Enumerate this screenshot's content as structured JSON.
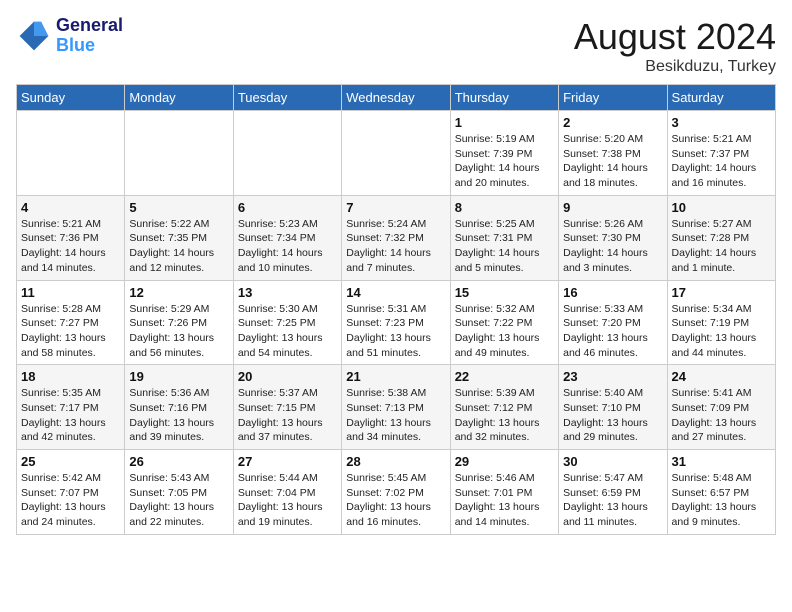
{
  "header": {
    "logo_line1": "General",
    "logo_line2": "Blue",
    "month_title": "August 2024",
    "location": "Besikduzu, Turkey"
  },
  "weekdays": [
    "Sunday",
    "Monday",
    "Tuesday",
    "Wednesday",
    "Thursday",
    "Friday",
    "Saturday"
  ],
  "weeks": [
    [
      null,
      null,
      null,
      null,
      {
        "day": 1,
        "sunrise": "5:19 AM",
        "sunset": "7:39 PM",
        "daylight": "14 hours and 20 minutes."
      },
      {
        "day": 2,
        "sunrise": "5:20 AM",
        "sunset": "7:38 PM",
        "daylight": "14 hours and 18 minutes."
      },
      {
        "day": 3,
        "sunrise": "5:21 AM",
        "sunset": "7:37 PM",
        "daylight": "14 hours and 16 minutes."
      }
    ],
    [
      {
        "day": 4,
        "sunrise": "5:21 AM",
        "sunset": "7:36 PM",
        "daylight": "14 hours and 14 minutes."
      },
      {
        "day": 5,
        "sunrise": "5:22 AM",
        "sunset": "7:35 PM",
        "daylight": "14 hours and 12 minutes."
      },
      {
        "day": 6,
        "sunrise": "5:23 AM",
        "sunset": "7:34 PM",
        "daylight": "14 hours and 10 minutes."
      },
      {
        "day": 7,
        "sunrise": "5:24 AM",
        "sunset": "7:32 PM",
        "daylight": "14 hours and 7 minutes."
      },
      {
        "day": 8,
        "sunrise": "5:25 AM",
        "sunset": "7:31 PM",
        "daylight": "14 hours and 5 minutes."
      },
      {
        "day": 9,
        "sunrise": "5:26 AM",
        "sunset": "7:30 PM",
        "daylight": "14 hours and 3 minutes."
      },
      {
        "day": 10,
        "sunrise": "5:27 AM",
        "sunset": "7:28 PM",
        "daylight": "14 hours and 1 minute."
      }
    ],
    [
      {
        "day": 11,
        "sunrise": "5:28 AM",
        "sunset": "7:27 PM",
        "daylight": "13 hours and 58 minutes."
      },
      {
        "day": 12,
        "sunrise": "5:29 AM",
        "sunset": "7:26 PM",
        "daylight": "13 hours and 56 minutes."
      },
      {
        "day": 13,
        "sunrise": "5:30 AM",
        "sunset": "7:25 PM",
        "daylight": "13 hours and 54 minutes."
      },
      {
        "day": 14,
        "sunrise": "5:31 AM",
        "sunset": "7:23 PM",
        "daylight": "13 hours and 51 minutes."
      },
      {
        "day": 15,
        "sunrise": "5:32 AM",
        "sunset": "7:22 PM",
        "daylight": "13 hours and 49 minutes."
      },
      {
        "day": 16,
        "sunrise": "5:33 AM",
        "sunset": "7:20 PM",
        "daylight": "13 hours and 46 minutes."
      },
      {
        "day": 17,
        "sunrise": "5:34 AM",
        "sunset": "7:19 PM",
        "daylight": "13 hours and 44 minutes."
      }
    ],
    [
      {
        "day": 18,
        "sunrise": "5:35 AM",
        "sunset": "7:17 PM",
        "daylight": "13 hours and 42 minutes."
      },
      {
        "day": 19,
        "sunrise": "5:36 AM",
        "sunset": "7:16 PM",
        "daylight": "13 hours and 39 minutes."
      },
      {
        "day": 20,
        "sunrise": "5:37 AM",
        "sunset": "7:15 PM",
        "daylight": "13 hours and 37 minutes."
      },
      {
        "day": 21,
        "sunrise": "5:38 AM",
        "sunset": "7:13 PM",
        "daylight": "13 hours and 34 minutes."
      },
      {
        "day": 22,
        "sunrise": "5:39 AM",
        "sunset": "7:12 PM",
        "daylight": "13 hours and 32 minutes."
      },
      {
        "day": 23,
        "sunrise": "5:40 AM",
        "sunset": "7:10 PM",
        "daylight": "13 hours and 29 minutes."
      },
      {
        "day": 24,
        "sunrise": "5:41 AM",
        "sunset": "7:09 PM",
        "daylight": "13 hours and 27 minutes."
      }
    ],
    [
      {
        "day": 25,
        "sunrise": "5:42 AM",
        "sunset": "7:07 PM",
        "daylight": "13 hours and 24 minutes."
      },
      {
        "day": 26,
        "sunrise": "5:43 AM",
        "sunset": "7:05 PM",
        "daylight": "13 hours and 22 minutes."
      },
      {
        "day": 27,
        "sunrise": "5:44 AM",
        "sunset": "7:04 PM",
        "daylight": "13 hours and 19 minutes."
      },
      {
        "day": 28,
        "sunrise": "5:45 AM",
        "sunset": "7:02 PM",
        "daylight": "13 hours and 16 minutes."
      },
      {
        "day": 29,
        "sunrise": "5:46 AM",
        "sunset": "7:01 PM",
        "daylight": "13 hours and 14 minutes."
      },
      {
        "day": 30,
        "sunrise": "5:47 AM",
        "sunset": "6:59 PM",
        "daylight": "13 hours and 11 minutes."
      },
      {
        "day": 31,
        "sunrise": "5:48 AM",
        "sunset": "6:57 PM",
        "daylight": "13 hours and 9 minutes."
      }
    ]
  ]
}
